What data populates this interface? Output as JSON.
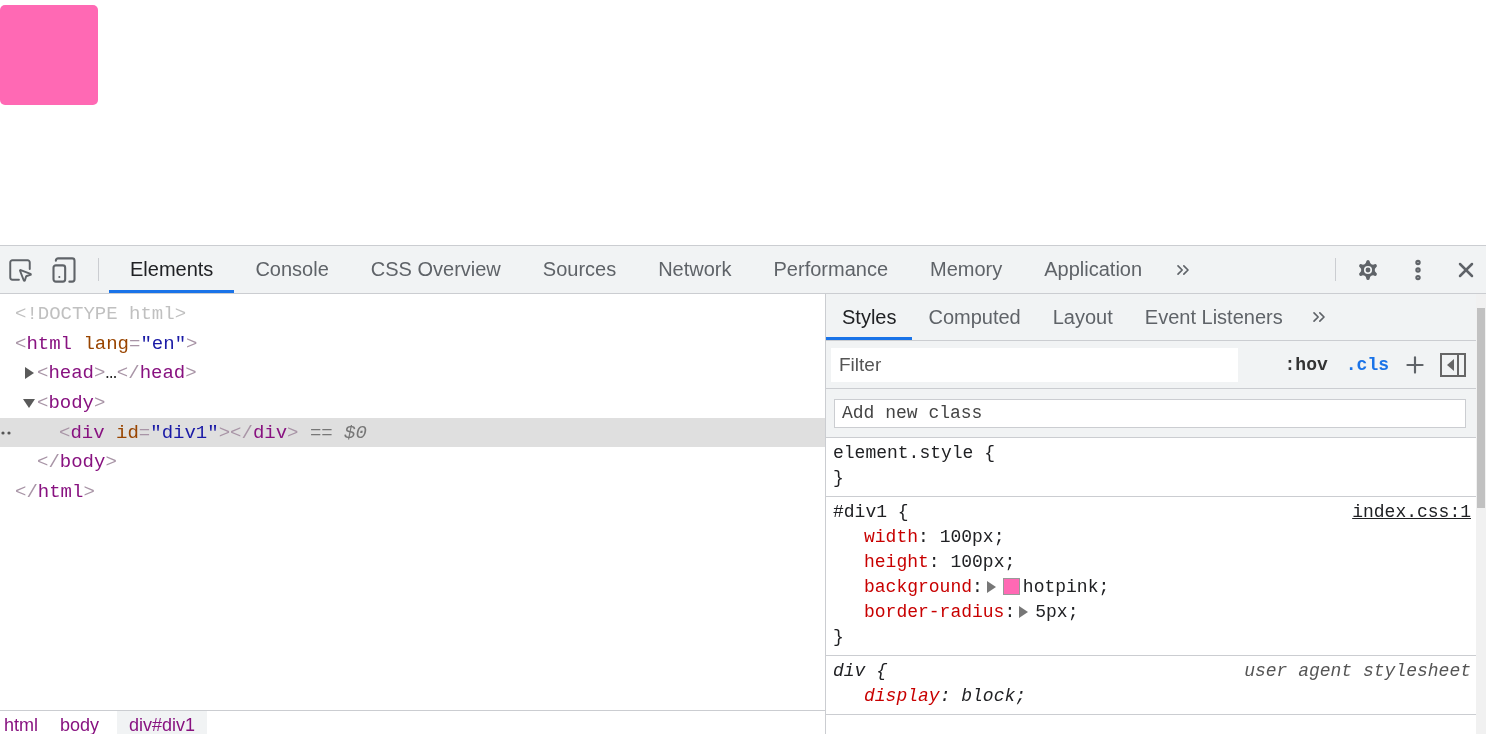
{
  "devtools": {
    "toolbar": {
      "tabs": [
        {
          "label": "Elements",
          "selected": true
        },
        {
          "label": "Console",
          "selected": false
        },
        {
          "label": "CSS Overview",
          "selected": false
        },
        {
          "label": "Sources",
          "selected": false
        },
        {
          "label": "Network",
          "selected": false
        },
        {
          "label": "Performance",
          "selected": false
        },
        {
          "label": "Memory",
          "selected": false
        },
        {
          "label": "Application",
          "selected": false
        }
      ]
    },
    "dom_tree": [
      {
        "selected": false,
        "tokens": [
          {
            "kind": "doctype",
            "text": "<!DOCTYPE html>"
          }
        ]
      },
      {
        "selected": false,
        "tokens": [
          {
            "kind": "bracket",
            "text": "<"
          },
          {
            "kind": "tag",
            "text": "html"
          },
          {
            "kind": "attr",
            "text": "lang"
          },
          {
            "kind": "bracket",
            "text": "="
          },
          {
            "kind": "value",
            "text": "\"en\""
          },
          {
            "kind": "bracket",
            "text": ">"
          }
        ],
        "close": [
          {
            "kind": "bracket",
            "text": "</"
          },
          {
            "kind": "tag",
            "text": "html"
          },
          {
            "kind": "bracket",
            "text": ">"
          }
        ],
        "children": [
          {
            "selected": false,
            "expanded": false,
            "tokens": [
              {
                "kind": "bracket",
                "text": "<"
              },
              {
                "kind": "tag",
                "text": "head"
              },
              {
                "kind": "bracket",
                "text": ">"
              },
              {
                "kind": "text",
                "text": "…"
              },
              {
                "kind": "bracket",
                "text": "</"
              },
              {
                "kind": "tag",
                "text": "head"
              },
              {
                "kind": "bracket",
                "text": ">"
              }
            ]
          },
          {
            "selected": false,
            "expanded": true,
            "tokens": [
              {
                "kind": "bracket",
                "text": "<"
              },
              {
                "kind": "tag",
                "text": "body"
              },
              {
                "kind": "bracket",
                "text": ">"
              }
            ],
            "close": [
              {
                "kind": "bracket",
                "text": "</"
              },
              {
                "kind": "tag",
                "text": "body"
              },
              {
                "kind": "bracket",
                "text": ">"
              }
            ],
            "children": [
              {
                "selected": true,
                "tokens": [
                  {
                    "kind": "bracket",
                    "text": "<"
                  },
                  {
                    "kind": "tag",
                    "text": "div"
                  },
                  {
                    "kind": "attr",
                    "text": "id"
                  },
                  {
                    "kind": "bracket",
                    "text": "="
                  },
                  {
                    "kind": "value",
                    "text": "\"div1\""
                  },
                  {
                    "kind": "bracket",
                    "text": "></"
                  },
                  {
                    "kind": "tag",
                    "text": "div"
                  },
                  {
                    "kind": "bracket",
                    "text": ">"
                  },
                  {
                    "kind": "hint",
                    "text": " == $0"
                  }
                ]
              }
            ]
          }
        ]
      }
    ],
    "breadcrumbs": [
      {
        "label": "html",
        "selected": false
      },
      {
        "label": "body",
        "selected": false
      },
      {
        "label": "div#div1",
        "selected": true
      }
    ],
    "styles_pane": {
      "tabs": [
        {
          "label": "Styles",
          "selected": true
        },
        {
          "label": "Computed",
          "selected": false
        },
        {
          "label": "Layout",
          "selected": false
        },
        {
          "label": "Event Listeners",
          "selected": false
        }
      ],
      "filter": {
        "placeholder": "Filter"
      },
      "hov": ":hov",
      "cls": ".cls",
      "class_field": {
        "placeholder": "Add new class"
      },
      "rules": [
        {
          "selector": "element.style {",
          "close": "}"
        },
        {
          "selector": "#div1 {",
          "origin": {
            "kind": "link",
            "text": "index.css:1"
          },
          "close": "}",
          "properties": [
            {
              "name": "width",
              "colon": ":",
              "value": "100px;"
            },
            {
              "name": "height",
              "colon": ":",
              "value": "100px;"
            },
            {
              "name": "background",
              "colon": ":",
              "value": "hotpink;",
              "expandable": true,
              "color": "#ff69b4"
            },
            {
              "name": "border-radius",
              "colon": ":",
              "value": "5px;",
              "expandable": true
            }
          ]
        },
        {
          "selector": "div {",
          "origin": {
            "kind": "user-agent",
            "text": "user agent stylesheet"
          },
          "properties": [
            {
              "name": "display",
              "colon": ":",
              "value": "block;"
            }
          ]
        }
      ]
    }
  }
}
